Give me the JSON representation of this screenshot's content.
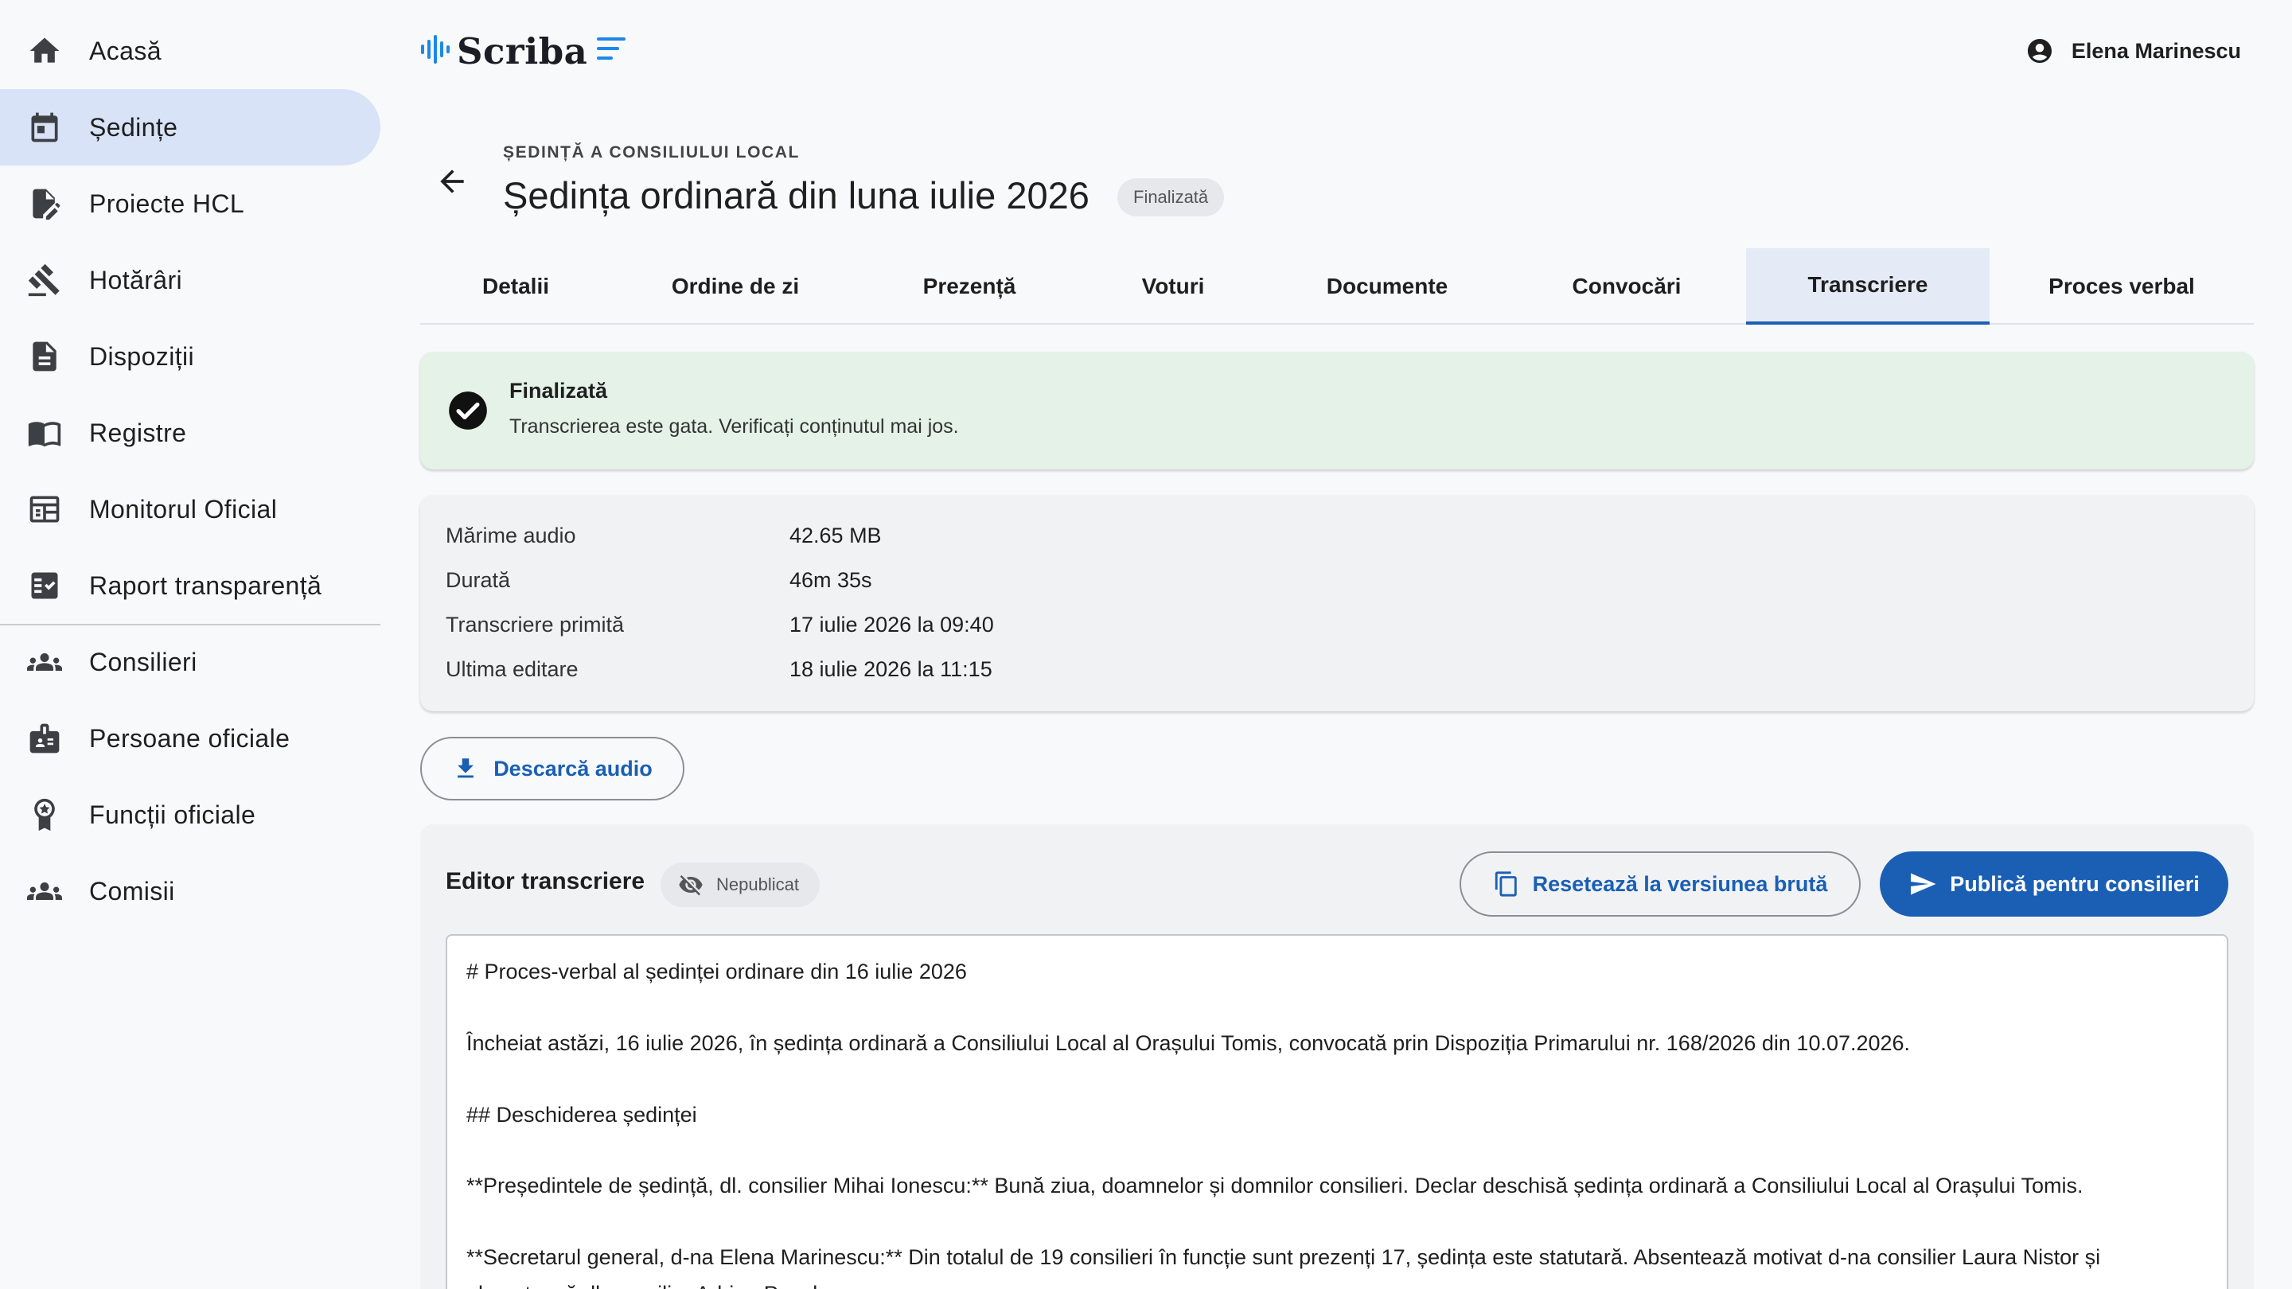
{
  "brand": {
    "name": "Scriba"
  },
  "user": {
    "name": "Elena Marinescu"
  },
  "sidebar": {
    "items": [
      {
        "label": "Acasă",
        "icon": "home-icon"
      },
      {
        "label": "Ședințe",
        "icon": "calendar-icon",
        "active": true
      },
      {
        "label": "Proiecte HCL",
        "icon": "edit-document-icon"
      },
      {
        "label": "Hotărâri",
        "icon": "gavel-icon"
      },
      {
        "label": "Dispoziții",
        "icon": "document-icon"
      },
      {
        "label": "Registre",
        "icon": "book-icon"
      },
      {
        "label": "Monitorul Oficial",
        "icon": "newspaper-icon"
      },
      {
        "label": "Raport transparență",
        "icon": "checklist-icon"
      },
      {
        "label": "Consilieri",
        "icon": "group-icon"
      },
      {
        "label": "Persoane oficiale",
        "icon": "badge-icon"
      },
      {
        "label": "Funcții oficiale",
        "icon": "award-icon"
      },
      {
        "label": "Comisii",
        "icon": "group-icon"
      }
    ]
  },
  "header": {
    "eyebrow": "ȘEDINȚĂ A CONSILIULUI LOCAL",
    "title": "Ședința ordinară din luna iulie 2026",
    "status": "Finalizată"
  },
  "tabs": [
    {
      "label": "Detalii"
    },
    {
      "label": "Ordine de zi"
    },
    {
      "label": "Prezență"
    },
    {
      "label": "Voturi"
    },
    {
      "label": "Documente"
    },
    {
      "label": "Convocări"
    },
    {
      "label": "Transcriere",
      "active": true
    },
    {
      "label": "Proces verbal"
    }
  ],
  "transcription_status": {
    "title": "Finalizată",
    "message": "Transcrierea este gata. Verificați conținutul mai jos."
  },
  "info": [
    {
      "label": "Mărime audio",
      "value": "42.65 MB"
    },
    {
      "label": "Durată",
      "value": "46m 35s"
    },
    {
      "label": "Transcriere primită",
      "value": "17 iulie 2026 la 09:40"
    },
    {
      "label": "Ultima editare",
      "value": "18 iulie 2026 la 11:15"
    }
  ],
  "download_button": {
    "label": "Descarcă audio"
  },
  "editor": {
    "title": "Editor transcriere",
    "publish_status": "Nepublicat",
    "reset_label": "Resetează la versiunea brută",
    "publish_label": "Publică pentru consilieri",
    "lines": [
      "# Proces-verbal al ședinței ordinare din 16 iulie 2026",
      "Încheiat astăzi, 16 iulie 2026, în ședința ordinară a Consiliului Local al Orașului Tomis, convocată prin Dispoziția Primarului nr. 168/2026 din 10.07.2026.",
      "## Deschiderea ședinței",
      "**Președintele de ședință, dl. consilier Mihai Ionescu:** Bună ziua, doamnelor și domnilor consilieri. Declar deschisă ședința ordinară a Consiliului Local al Orașului Tomis.",
      "**Secretarul general, d-na Elena Marinescu:** Din totalul de 19 consilieri în funcție sunt prezenți 17, ședința este statutară. Absentează motivat d-na consilier Laura Nistor și",
      "absentează dl. consilier Adrian Pavel."
    ]
  },
  "colors": {
    "accent": "#1a5fb4",
    "active_nav": "#d9e3f7",
    "success_bg": "#e4f2e7",
    "card_bg": "#f1f2f4",
    "brand_wave": "#1e88e5"
  }
}
